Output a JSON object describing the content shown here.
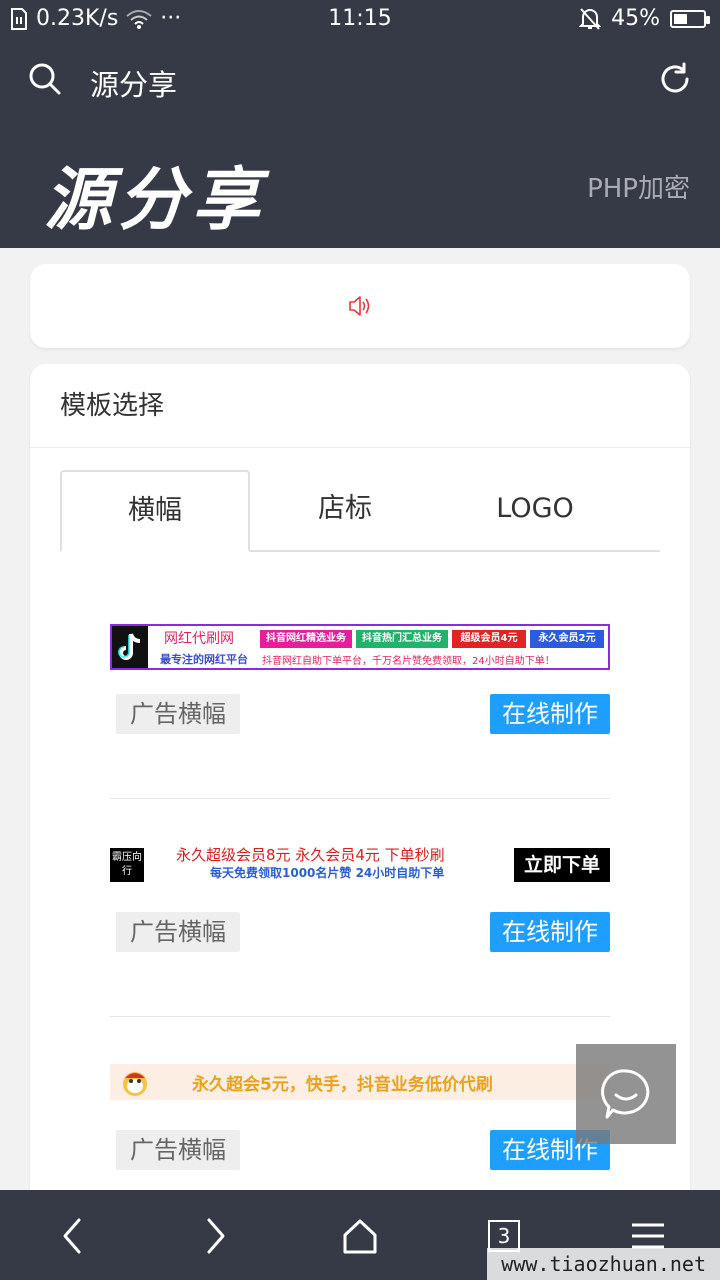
{
  "status_bar": {
    "network_speed": "0.23K/s",
    "more": "···",
    "time": "11:15",
    "battery": "45%",
    "battery_level": 0.45
  },
  "browser": {
    "title": "源分享"
  },
  "site": {
    "logo_text": "源分享",
    "nav_link": "PHP加密"
  },
  "template_card": {
    "title": "模板选择",
    "tabs": [
      "横幅",
      "店标",
      "LOGO"
    ],
    "active_tab": 0
  },
  "banners": [
    {
      "tag": "广告横幅",
      "button": "在线制作",
      "image": {
        "name": "网红代刷网",
        "slogan": "最专注的网红平台",
        "chips": [
          "抖音网红精选业务",
          "抖音热门汇总业务",
          "超级会员4元",
          "永久会员2元"
        ],
        "chip_colors": [
          "#e61e9c",
          "#22b36b",
          "#e02424",
          "#2d5be0"
        ],
        "desc": "抖音网红自助下单平台，千万名片赞免费领取，24小时自助下单！"
      }
    },
    {
      "tag": "广告横幅",
      "button": "在线制作",
      "image": {
        "seal": "霸压向行",
        "line1": "永久超级会员8元  永久会员4元  下单秒刷",
        "line2": "每天免费领取1000名片赞  24小时自助下单",
        "cta": "立即下单"
      }
    },
    {
      "tag": "广告横幅",
      "button": "在线制作",
      "image": {
        "text": "永久超会5元，快手，抖音业务低价代刷"
      }
    }
  ],
  "bottom_nav": {
    "tab_count": "3"
  },
  "watermark": "www.tiaozhuan.net",
  "colors": {
    "header_bg": "#363a46",
    "accent_blue": "#1e9fff",
    "page_bg": "#f2f2f2"
  }
}
